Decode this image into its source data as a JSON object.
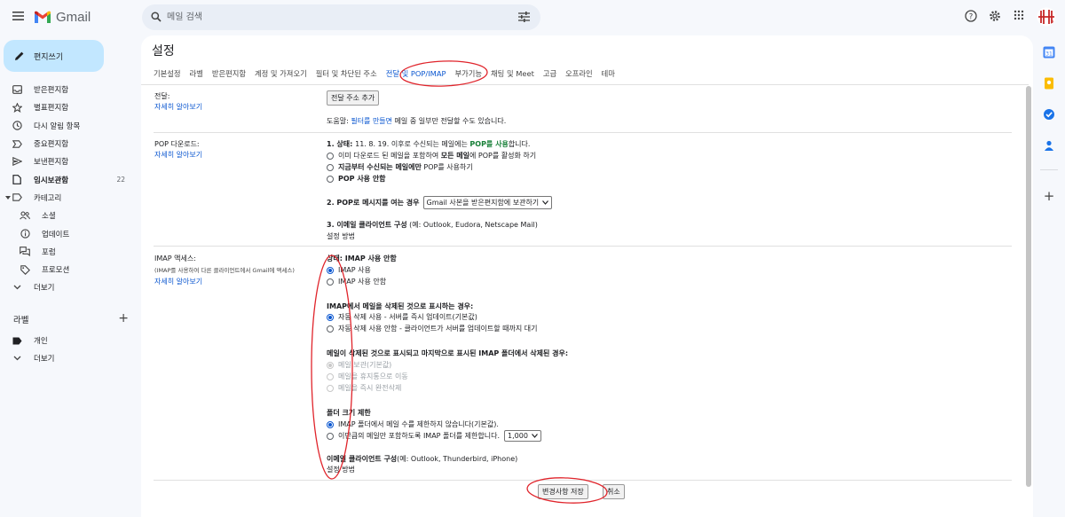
{
  "app": {
    "name": "Gmail"
  },
  "search": {
    "placeholder": "메일 검색"
  },
  "compose": {
    "label": "편지쓰기"
  },
  "nav": [
    {
      "label": "받은편지함",
      "icon": "inbox-icon",
      "bold": false,
      "count": ""
    },
    {
      "label": "별표편지함",
      "icon": "star-icon",
      "bold": false,
      "count": ""
    },
    {
      "label": "다시 알림 항목",
      "icon": "clock-icon",
      "bold": false,
      "count": ""
    },
    {
      "label": "중요편지함",
      "icon": "important-icon",
      "bold": false,
      "count": ""
    },
    {
      "label": "보낸편지함",
      "icon": "send-icon",
      "bold": false,
      "count": ""
    },
    {
      "label": "임시보관함",
      "icon": "draft-icon",
      "bold": true,
      "count": "22"
    },
    {
      "label": "카테고리",
      "icon": "label-icon",
      "bold": false,
      "count": ""
    },
    {
      "label": "소셜",
      "icon": "people-icon",
      "bold": false,
      "count": ""
    },
    {
      "label": "업데이트",
      "icon": "info-icon",
      "bold": false,
      "count": ""
    },
    {
      "label": "포럼",
      "icon": "forum-icon",
      "bold": false,
      "count": ""
    },
    {
      "label": "프로모션",
      "icon": "tag-icon",
      "bold": false,
      "count": ""
    },
    {
      "label": "더보기",
      "icon": "chevron-down-icon",
      "bold": false,
      "count": ""
    }
  ],
  "labels": {
    "title": "라벨",
    "items": [
      {
        "label": "개인"
      },
      {
        "label": "더보기"
      }
    ]
  },
  "settings": {
    "title": "설정",
    "tabs": [
      "기본설정",
      "라벨",
      "받은편지함",
      "계정 및 가져오기",
      "필터 및 차단된 주소",
      "전달 및 POP/IMAP",
      "부가기능",
      "채팅 및 Meet",
      "고급",
      "오프라인",
      "테마"
    ],
    "active_tab": "전달 및 POP/IMAP",
    "forwarding": {
      "label": "전달:",
      "learn_more": "자세히 알아보기",
      "add_button": "전달 주소 추가",
      "tip_prefix": "도움말: ",
      "tip_link": "필터를 만들면",
      "tip_suffix": " 메일 중 일부만 전달할 수도 있습니다."
    },
    "pop": {
      "label": "POP 다운로드:",
      "learn_more": "자세히 알아보기",
      "status_prefix": "1. 상태: ",
      "status_date": "11. 8. 19. 이후로 수신되는 메일에는 ",
      "status_value": "POP를 사용",
      "status_suffix": "합니다.",
      "options": [
        {
          "pre": "이미 다운로드 된 메일을 포함하여 ",
          "bold": "모든 메일",
          "post": "에 POP를 활성화 하기",
          "checked": false
        },
        {
          "pre": "",
          "bold": "지금부터 수신되는 메일에만",
          "post": " POP를 사용하기",
          "checked": false
        },
        {
          "pre": "",
          "bold": "POP 사용 안함",
          "post": "",
          "checked": false
        }
      ],
      "when_access_label": "2. POP로 메시지를 여는 경우",
      "when_access_value": "Gmail 사본을 받은편지함에 보관하기",
      "client_label": "3. 이메일 클라이언트 구성",
      "client_hint": " (예: Outlook, Eudora, Netscape Mail)",
      "client_link": "설정 방법"
    },
    "imap": {
      "label": "IMAP 액세스:",
      "desc": "(IMAP를 사용하여 다른 클라이언트에서 Gmail에 액세스)",
      "learn_more": "자세히 알아보기",
      "status_prefix": "상태: ",
      "status_value": "IMAP 사용 안함",
      "status_options": [
        {
          "label": "IMAP 사용",
          "checked": true
        },
        {
          "label": "IMAP 사용 안함",
          "checked": false
        }
      ],
      "deleted_title": "IMAP에서 메일을 삭제된 것으로 표시하는 경우:",
      "deleted_options": [
        {
          "label": "자동 삭제 사용 - 서버를 즉시 업데이트(기본값)",
          "checked": true
        },
        {
          "label": "자동 삭제 사용 안함 - 클라이언트가 서버를 업데이트할 때까지 대기",
          "checked": false
        }
      ],
      "expunge_title": "메일이 삭제된 것으로 표시되고 마지막으로 표시된 IMAP 폴더에서 삭제된 경우:",
      "expunge_options": [
        {
          "label": "메일 보관(기본값)",
          "checked": true
        },
        {
          "label": "메일을 휴지통으로 이동",
          "checked": false
        },
        {
          "label": "메일을 즉시 완전삭제",
          "checked": false
        }
      ],
      "folder_title": "폴더 크기 제한",
      "folder_options": [
        {
          "label": "IMAP 폴더에서 메일 수를 제한하지 않습니다(기본값).",
          "checked": true
        },
        {
          "label": "이만큼의 메일만 포함하도록 IMAP 폴더를 제한합니다.",
          "checked": false
        }
      ],
      "folder_limit": "1,000",
      "client_label": "이메일 클라이언트 구성",
      "client_hint": "(예: Outlook, Thunderbird, iPhone)",
      "client_link": "설정 방법"
    },
    "save_button": "변경사항 저장",
    "cancel_button": "취소"
  },
  "colors": {
    "accent": "#0b57d0",
    "compose_bg": "#c2e7ff",
    "annotation": "#e0242b",
    "pop_status": "#188038"
  }
}
